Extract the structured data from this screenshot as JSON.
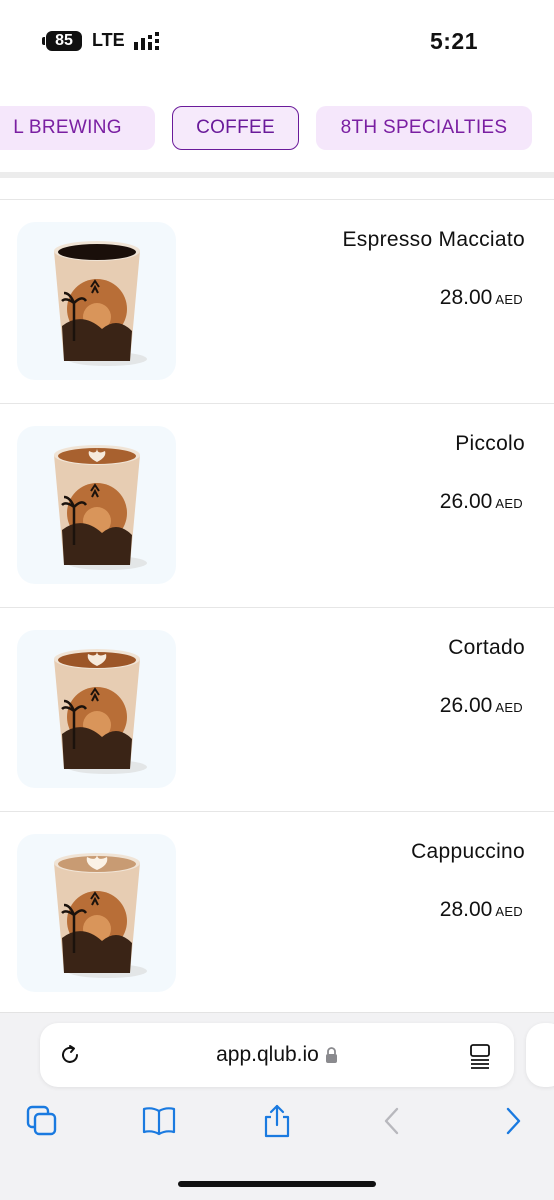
{
  "status_bar": {
    "battery": "85",
    "network": "LTE",
    "time": "5:21"
  },
  "categories": [
    {
      "label": "L BREWING",
      "active": false
    },
    {
      "label": "COFFEE",
      "active": true
    },
    {
      "label": "8TH SPECIALTIES",
      "active": false
    }
  ],
  "menu_items": [
    {
      "name": "Espresso Macciato",
      "price": "28.00",
      "currency": "AED",
      "image": "espresso-cup"
    },
    {
      "name": "Piccolo",
      "price": "26.00",
      "currency": "AED",
      "image": "latte-art-cup"
    },
    {
      "name": "Cortado",
      "price": "26.00",
      "currency": "AED",
      "image": "latte-art-cup"
    },
    {
      "name": "Cappuccino",
      "price": "28.00",
      "currency": "AED",
      "image": "latte-art-cup"
    }
  ],
  "browser": {
    "url": "app.qlub.io"
  },
  "colors": {
    "accent": "#6a1b9a",
    "tab_bg": "#f5e7fb",
    "ios_blue": "#1a7ae0"
  }
}
